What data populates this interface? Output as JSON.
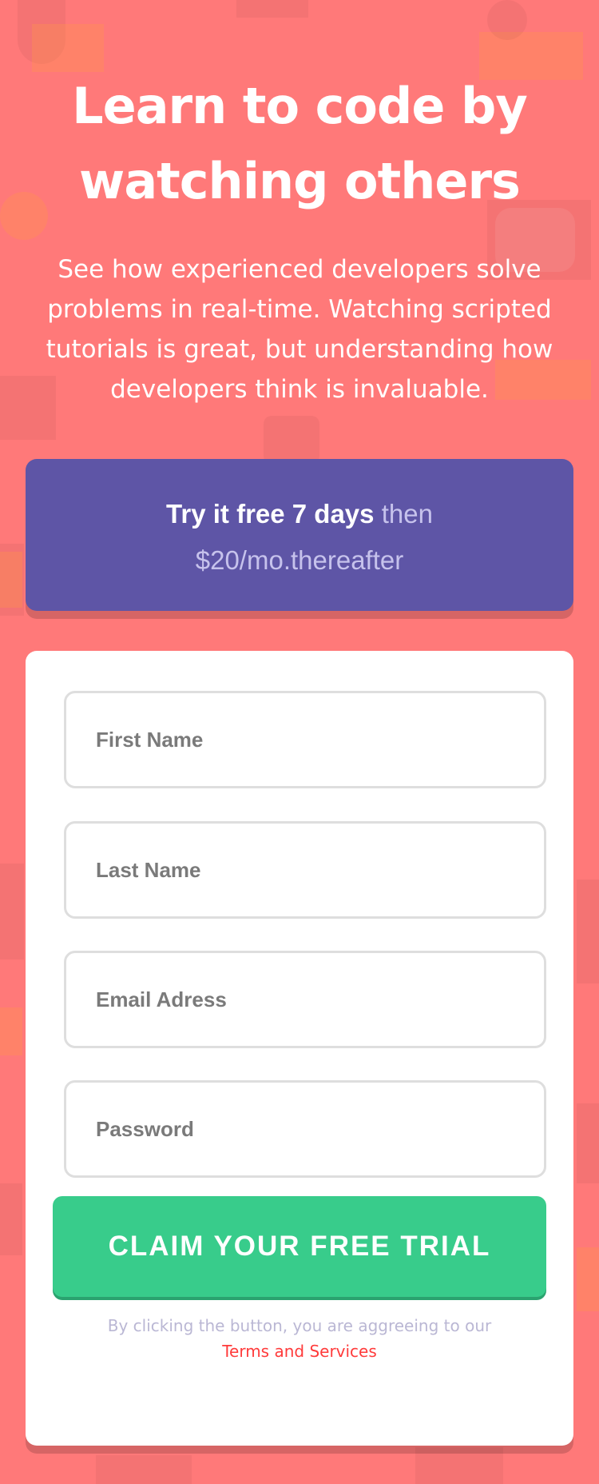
{
  "hero": {
    "title_line1": "Learn to code by",
    "title_line2": "watching others",
    "description": "See how experienced developers solve problems in real-time. Watching scripted tutorials is great, but understanding how developers think is invaluable."
  },
  "offer": {
    "strong": "Try it free 7 days",
    "then": "then",
    "price": "$20/mo.thereafter"
  },
  "form": {
    "first_name_placeholder": "First Name",
    "last_name_placeholder": "Last Name",
    "email_placeholder": "Email Adress",
    "password_placeholder": "Password",
    "submit_label": "CLAIM YOUR FREE TRIAL",
    "terms_text": "By clicking the button, you are aggreeing to our",
    "terms_link": "Terms and Services"
  },
  "colors": {
    "background": "#ff7979",
    "offer_box": "#5e55a6",
    "button": "#38cc8b",
    "terms_link": "#ff3b3b",
    "card": "#ffffff"
  }
}
